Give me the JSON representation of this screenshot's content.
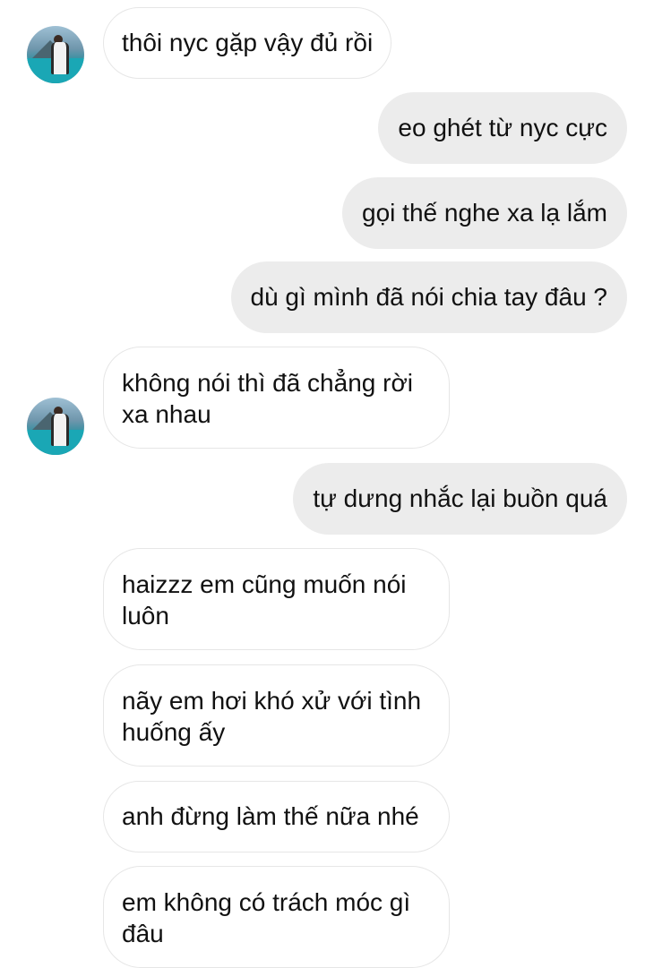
{
  "thread": {
    "messages": [
      {
        "sender": "other",
        "text": "thôi nyc gặp vậy đủ rồi"
      },
      {
        "sender": "me",
        "text": "eo ghét từ nyc cực"
      },
      {
        "sender": "me",
        "text": "gọi thế nghe xa lạ lắm"
      },
      {
        "sender": "me",
        "text": "dù gì mình đã nói chia tay đâu ?"
      },
      {
        "sender": "other",
        "text": "không nói thì đã chẳng rời xa nhau"
      },
      {
        "sender": "me",
        "text": "tự dưng nhắc lại buồn quá"
      },
      {
        "sender": "other",
        "text": "haizzz em cũng muốn nói luôn"
      },
      {
        "sender": "other",
        "text": "nãy em hơi khó xử với tình huống ấy"
      },
      {
        "sender": "other",
        "text": "anh đừng làm thế nữa nhé"
      },
      {
        "sender": "other",
        "text": "em không có trách móc gì đâu"
      }
    ]
  },
  "colors": {
    "incoming_bubble": "#ffffff",
    "incoming_border": "#e6e6e6",
    "outgoing_bubble": "#ececec",
    "text": "#111111"
  },
  "icons": {
    "avatar": "profile-photo-lake-person"
  }
}
